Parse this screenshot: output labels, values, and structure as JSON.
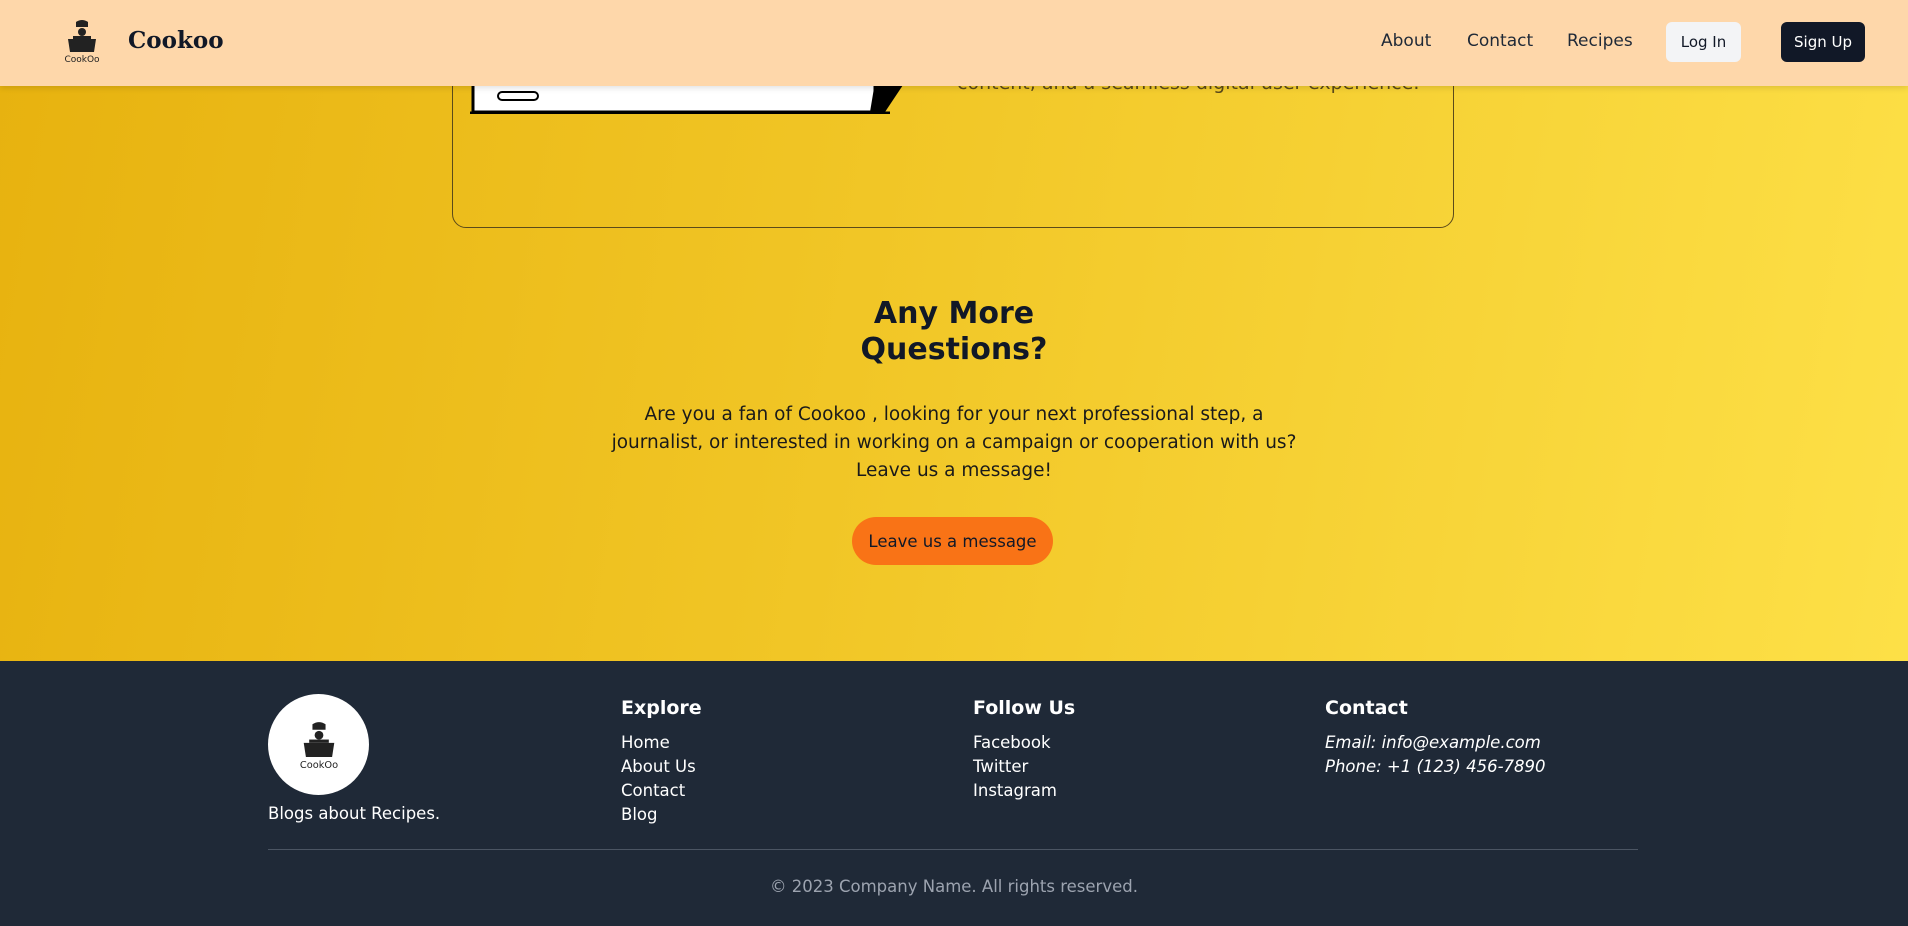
{
  "colors": {
    "navbar_bg": "#fed7aa",
    "accent_orange": "#f97316",
    "footer_bg": "#1f2937",
    "signup_bg": "#111827"
  },
  "header": {
    "brand": "Cookoo",
    "logo_text": "CookOo",
    "nav": [
      "About",
      "Contact",
      "Recipes"
    ],
    "login": "Log In",
    "signup": "Sign Up"
  },
  "card": {
    "text": "content, and a seamless digital user-experience."
  },
  "questions": {
    "title_line1": "Any More",
    "title_line2": "Questions?",
    "text": "Are you a fan of Cookoo , looking for your next professional step, a journalist, or interested in working on a campaign or cooperation with us? Leave us a message!",
    "button": "Leave us a message"
  },
  "footer": {
    "logo_text": "CookOo",
    "tagline": "Blogs about Recipes.",
    "explore": {
      "title": "Explore",
      "links": [
        "Home",
        "About Us",
        "Contact",
        "Blog"
      ]
    },
    "follow": {
      "title": "Follow Us",
      "links": [
        "Facebook",
        "Twitter",
        "Instagram"
      ]
    },
    "contact": {
      "title": "Contact",
      "email": "Email: info@example.com",
      "phone": "Phone: +1 (123) 456-7890"
    },
    "copyright": "© 2023 Company Name. All rights reserved."
  }
}
